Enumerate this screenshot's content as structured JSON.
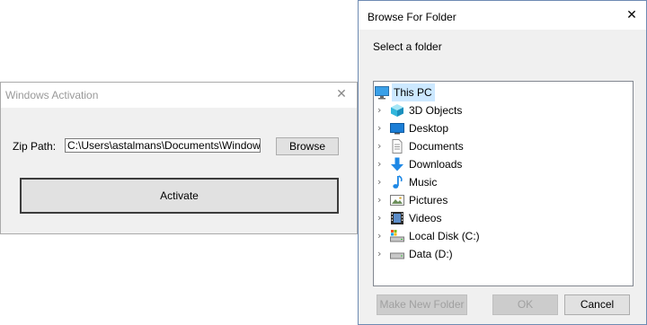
{
  "activation_window": {
    "title": "Windows Activation",
    "zip_label": "Zip Path:",
    "zip_value": "C:\\Users\\astalmans\\Documents\\Windows Li",
    "browse_label": "Browse",
    "activate_label": "Activate"
  },
  "browse_dialog": {
    "title": "Browse For Folder",
    "instruction": "Select a folder",
    "root": {
      "label": "This PC",
      "icon": "monitor-icon"
    },
    "items": [
      {
        "label": "3D Objects",
        "icon": "cube-icon"
      },
      {
        "label": "Desktop",
        "icon": "desktop-icon"
      },
      {
        "label": "Documents",
        "icon": "document-icon"
      },
      {
        "label": "Downloads",
        "icon": "download-arrow-icon"
      },
      {
        "label": "Music",
        "icon": "music-note-icon"
      },
      {
        "label": "Pictures",
        "icon": "picture-icon"
      },
      {
        "label": "Videos",
        "icon": "film-icon"
      },
      {
        "label": "Local Disk (C:)",
        "icon": "system-drive-icon"
      },
      {
        "label": "Data (D:)",
        "icon": "drive-icon"
      }
    ],
    "make_new_folder_label": "Make New Folder",
    "ok_label": "OK",
    "cancel_label": "Cancel"
  },
  "colors": {
    "selection": "#cce8ff",
    "dialog_bg": "#f0f0f0",
    "button_bg": "#e1e1e1",
    "accent_blue": "#1e90ff"
  }
}
